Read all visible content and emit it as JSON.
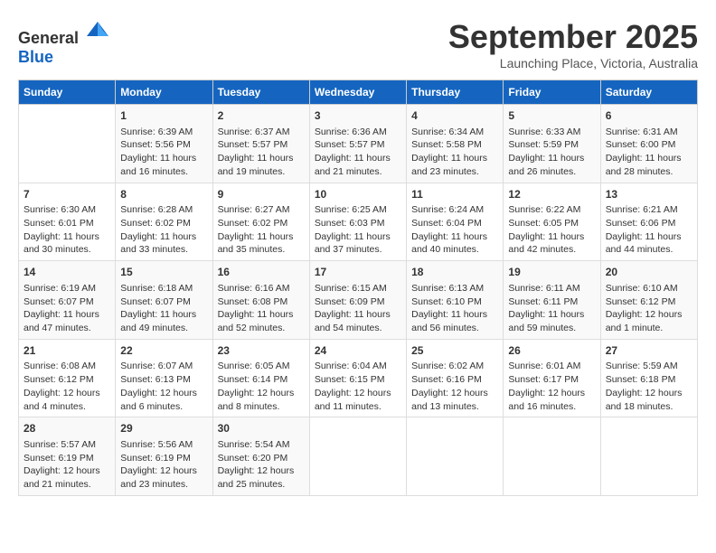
{
  "header": {
    "logo_general": "General",
    "logo_blue": "Blue",
    "month_year": "September 2025",
    "location": "Launching Place, Victoria, Australia"
  },
  "days_of_week": [
    "Sunday",
    "Monday",
    "Tuesday",
    "Wednesday",
    "Thursday",
    "Friday",
    "Saturday"
  ],
  "weeks": [
    [
      {
        "day": "",
        "info": ""
      },
      {
        "day": "1",
        "info": "Sunrise: 6:39 AM\nSunset: 5:56 PM\nDaylight: 11 hours\nand 16 minutes."
      },
      {
        "day": "2",
        "info": "Sunrise: 6:37 AM\nSunset: 5:57 PM\nDaylight: 11 hours\nand 19 minutes."
      },
      {
        "day": "3",
        "info": "Sunrise: 6:36 AM\nSunset: 5:57 PM\nDaylight: 11 hours\nand 21 minutes."
      },
      {
        "day": "4",
        "info": "Sunrise: 6:34 AM\nSunset: 5:58 PM\nDaylight: 11 hours\nand 23 minutes."
      },
      {
        "day": "5",
        "info": "Sunrise: 6:33 AM\nSunset: 5:59 PM\nDaylight: 11 hours\nand 26 minutes."
      },
      {
        "day": "6",
        "info": "Sunrise: 6:31 AM\nSunset: 6:00 PM\nDaylight: 11 hours\nand 28 minutes."
      }
    ],
    [
      {
        "day": "7",
        "info": "Sunrise: 6:30 AM\nSunset: 6:01 PM\nDaylight: 11 hours\nand 30 minutes."
      },
      {
        "day": "8",
        "info": "Sunrise: 6:28 AM\nSunset: 6:02 PM\nDaylight: 11 hours\nand 33 minutes."
      },
      {
        "day": "9",
        "info": "Sunrise: 6:27 AM\nSunset: 6:02 PM\nDaylight: 11 hours\nand 35 minutes."
      },
      {
        "day": "10",
        "info": "Sunrise: 6:25 AM\nSunset: 6:03 PM\nDaylight: 11 hours\nand 37 minutes."
      },
      {
        "day": "11",
        "info": "Sunrise: 6:24 AM\nSunset: 6:04 PM\nDaylight: 11 hours\nand 40 minutes."
      },
      {
        "day": "12",
        "info": "Sunrise: 6:22 AM\nSunset: 6:05 PM\nDaylight: 11 hours\nand 42 minutes."
      },
      {
        "day": "13",
        "info": "Sunrise: 6:21 AM\nSunset: 6:06 PM\nDaylight: 11 hours\nand 44 minutes."
      }
    ],
    [
      {
        "day": "14",
        "info": "Sunrise: 6:19 AM\nSunset: 6:07 PM\nDaylight: 11 hours\nand 47 minutes."
      },
      {
        "day": "15",
        "info": "Sunrise: 6:18 AM\nSunset: 6:07 PM\nDaylight: 11 hours\nand 49 minutes."
      },
      {
        "day": "16",
        "info": "Sunrise: 6:16 AM\nSunset: 6:08 PM\nDaylight: 11 hours\nand 52 minutes."
      },
      {
        "day": "17",
        "info": "Sunrise: 6:15 AM\nSunset: 6:09 PM\nDaylight: 11 hours\nand 54 minutes."
      },
      {
        "day": "18",
        "info": "Sunrise: 6:13 AM\nSunset: 6:10 PM\nDaylight: 11 hours\nand 56 minutes."
      },
      {
        "day": "19",
        "info": "Sunrise: 6:11 AM\nSunset: 6:11 PM\nDaylight: 11 hours\nand 59 minutes."
      },
      {
        "day": "20",
        "info": "Sunrise: 6:10 AM\nSunset: 6:12 PM\nDaylight: 12 hours\nand 1 minute."
      }
    ],
    [
      {
        "day": "21",
        "info": "Sunrise: 6:08 AM\nSunset: 6:12 PM\nDaylight: 12 hours\nand 4 minutes."
      },
      {
        "day": "22",
        "info": "Sunrise: 6:07 AM\nSunset: 6:13 PM\nDaylight: 12 hours\nand 6 minutes."
      },
      {
        "day": "23",
        "info": "Sunrise: 6:05 AM\nSunset: 6:14 PM\nDaylight: 12 hours\nand 8 minutes."
      },
      {
        "day": "24",
        "info": "Sunrise: 6:04 AM\nSunset: 6:15 PM\nDaylight: 12 hours\nand 11 minutes."
      },
      {
        "day": "25",
        "info": "Sunrise: 6:02 AM\nSunset: 6:16 PM\nDaylight: 12 hours\nand 13 minutes."
      },
      {
        "day": "26",
        "info": "Sunrise: 6:01 AM\nSunset: 6:17 PM\nDaylight: 12 hours\nand 16 minutes."
      },
      {
        "day": "27",
        "info": "Sunrise: 5:59 AM\nSunset: 6:18 PM\nDaylight: 12 hours\nand 18 minutes."
      }
    ],
    [
      {
        "day": "28",
        "info": "Sunrise: 5:57 AM\nSunset: 6:19 PM\nDaylight: 12 hours\nand 21 minutes."
      },
      {
        "day": "29",
        "info": "Sunrise: 5:56 AM\nSunset: 6:19 PM\nDaylight: 12 hours\nand 23 minutes."
      },
      {
        "day": "30",
        "info": "Sunrise: 5:54 AM\nSunset: 6:20 PM\nDaylight: 12 hours\nand 25 minutes."
      },
      {
        "day": "",
        "info": ""
      },
      {
        "day": "",
        "info": ""
      },
      {
        "day": "",
        "info": ""
      },
      {
        "day": "",
        "info": ""
      }
    ]
  ]
}
